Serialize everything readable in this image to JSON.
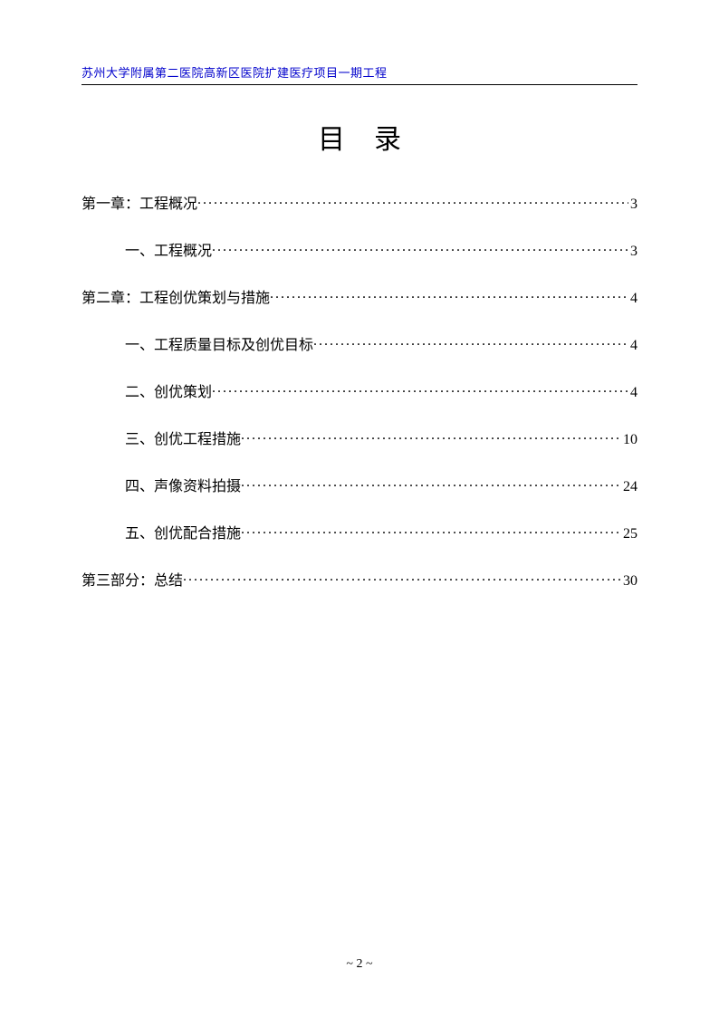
{
  "header": "苏州大学附属第二医院高新区医院扩建医疗项目一期工程",
  "title": "目录",
  "toc": [
    {
      "level": 1,
      "text": "第一章：工程概况",
      "page": "3"
    },
    {
      "level": 2,
      "text": "一、工程概况",
      "page": "3"
    },
    {
      "level": 1,
      "text": "第二章：工程创优策划与措施",
      "page": "4"
    },
    {
      "level": 2,
      "text": "一、工程质量目标及创优目标",
      "page": "4"
    },
    {
      "level": 2,
      "text": "二、创优策划",
      "page": "4"
    },
    {
      "level": 2,
      "text": "三、创优工程措施",
      "page": "10"
    },
    {
      "level": 2,
      "text": "四、声像资料拍摄",
      "page": "24"
    },
    {
      "level": 2,
      "text": "五、创优配合措施",
      "page": "25"
    },
    {
      "level": 1,
      "text": "第三部分：总结",
      "page": "30"
    }
  ],
  "pageLabel": "~ 2 ~"
}
